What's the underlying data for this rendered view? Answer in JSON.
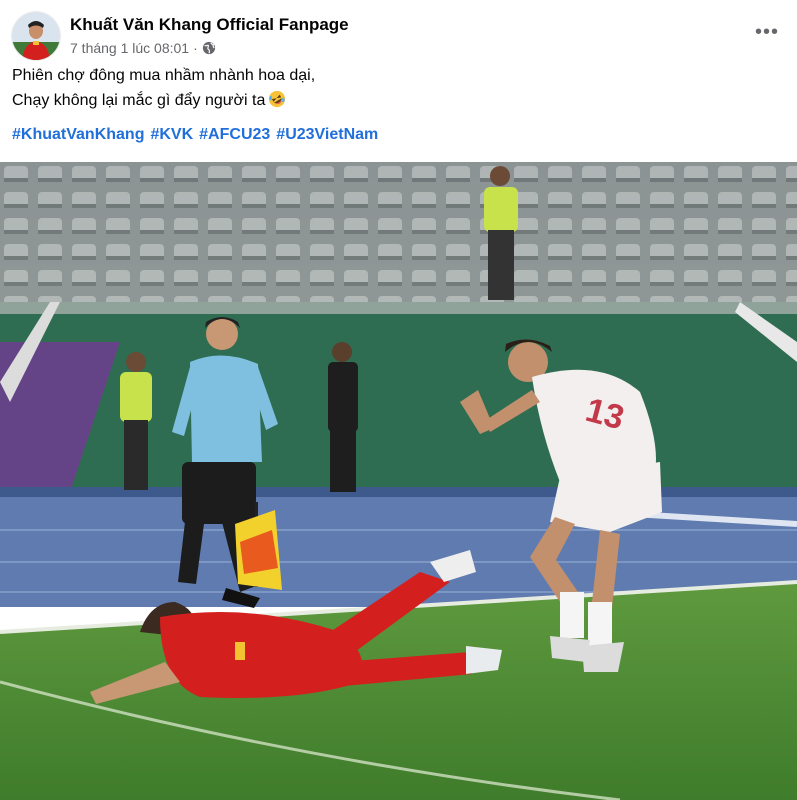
{
  "post": {
    "page_name": "Khuất Văn Khang Official Fanpage",
    "timestamp": "7 tháng 1 lúc 08:01",
    "separator": "·",
    "audience_icon": "globe-icon",
    "more_label": "•••",
    "caption_lines": [
      "Phiên chợ đông mua nhầm nhành hoa dại,",
      "Chạy không lại mắc gì đẩy người ta"
    ],
    "caption_emoji": "rolling-on-floor-laughing-emoji",
    "hashtags": [
      "#KhuatVanKhang",
      "#KVK",
      "#AFCU23",
      "#U23VietNam"
    ],
    "photo": {
      "jersey_number": "13",
      "colors": {
        "pitch": "#4f8d35",
        "vietnam_kit": "#d3201e",
        "opponent_kit": "#f2efee",
        "referee_shirt": "#7fc0e0",
        "hashtag_blue": "#216fdb"
      }
    }
  }
}
